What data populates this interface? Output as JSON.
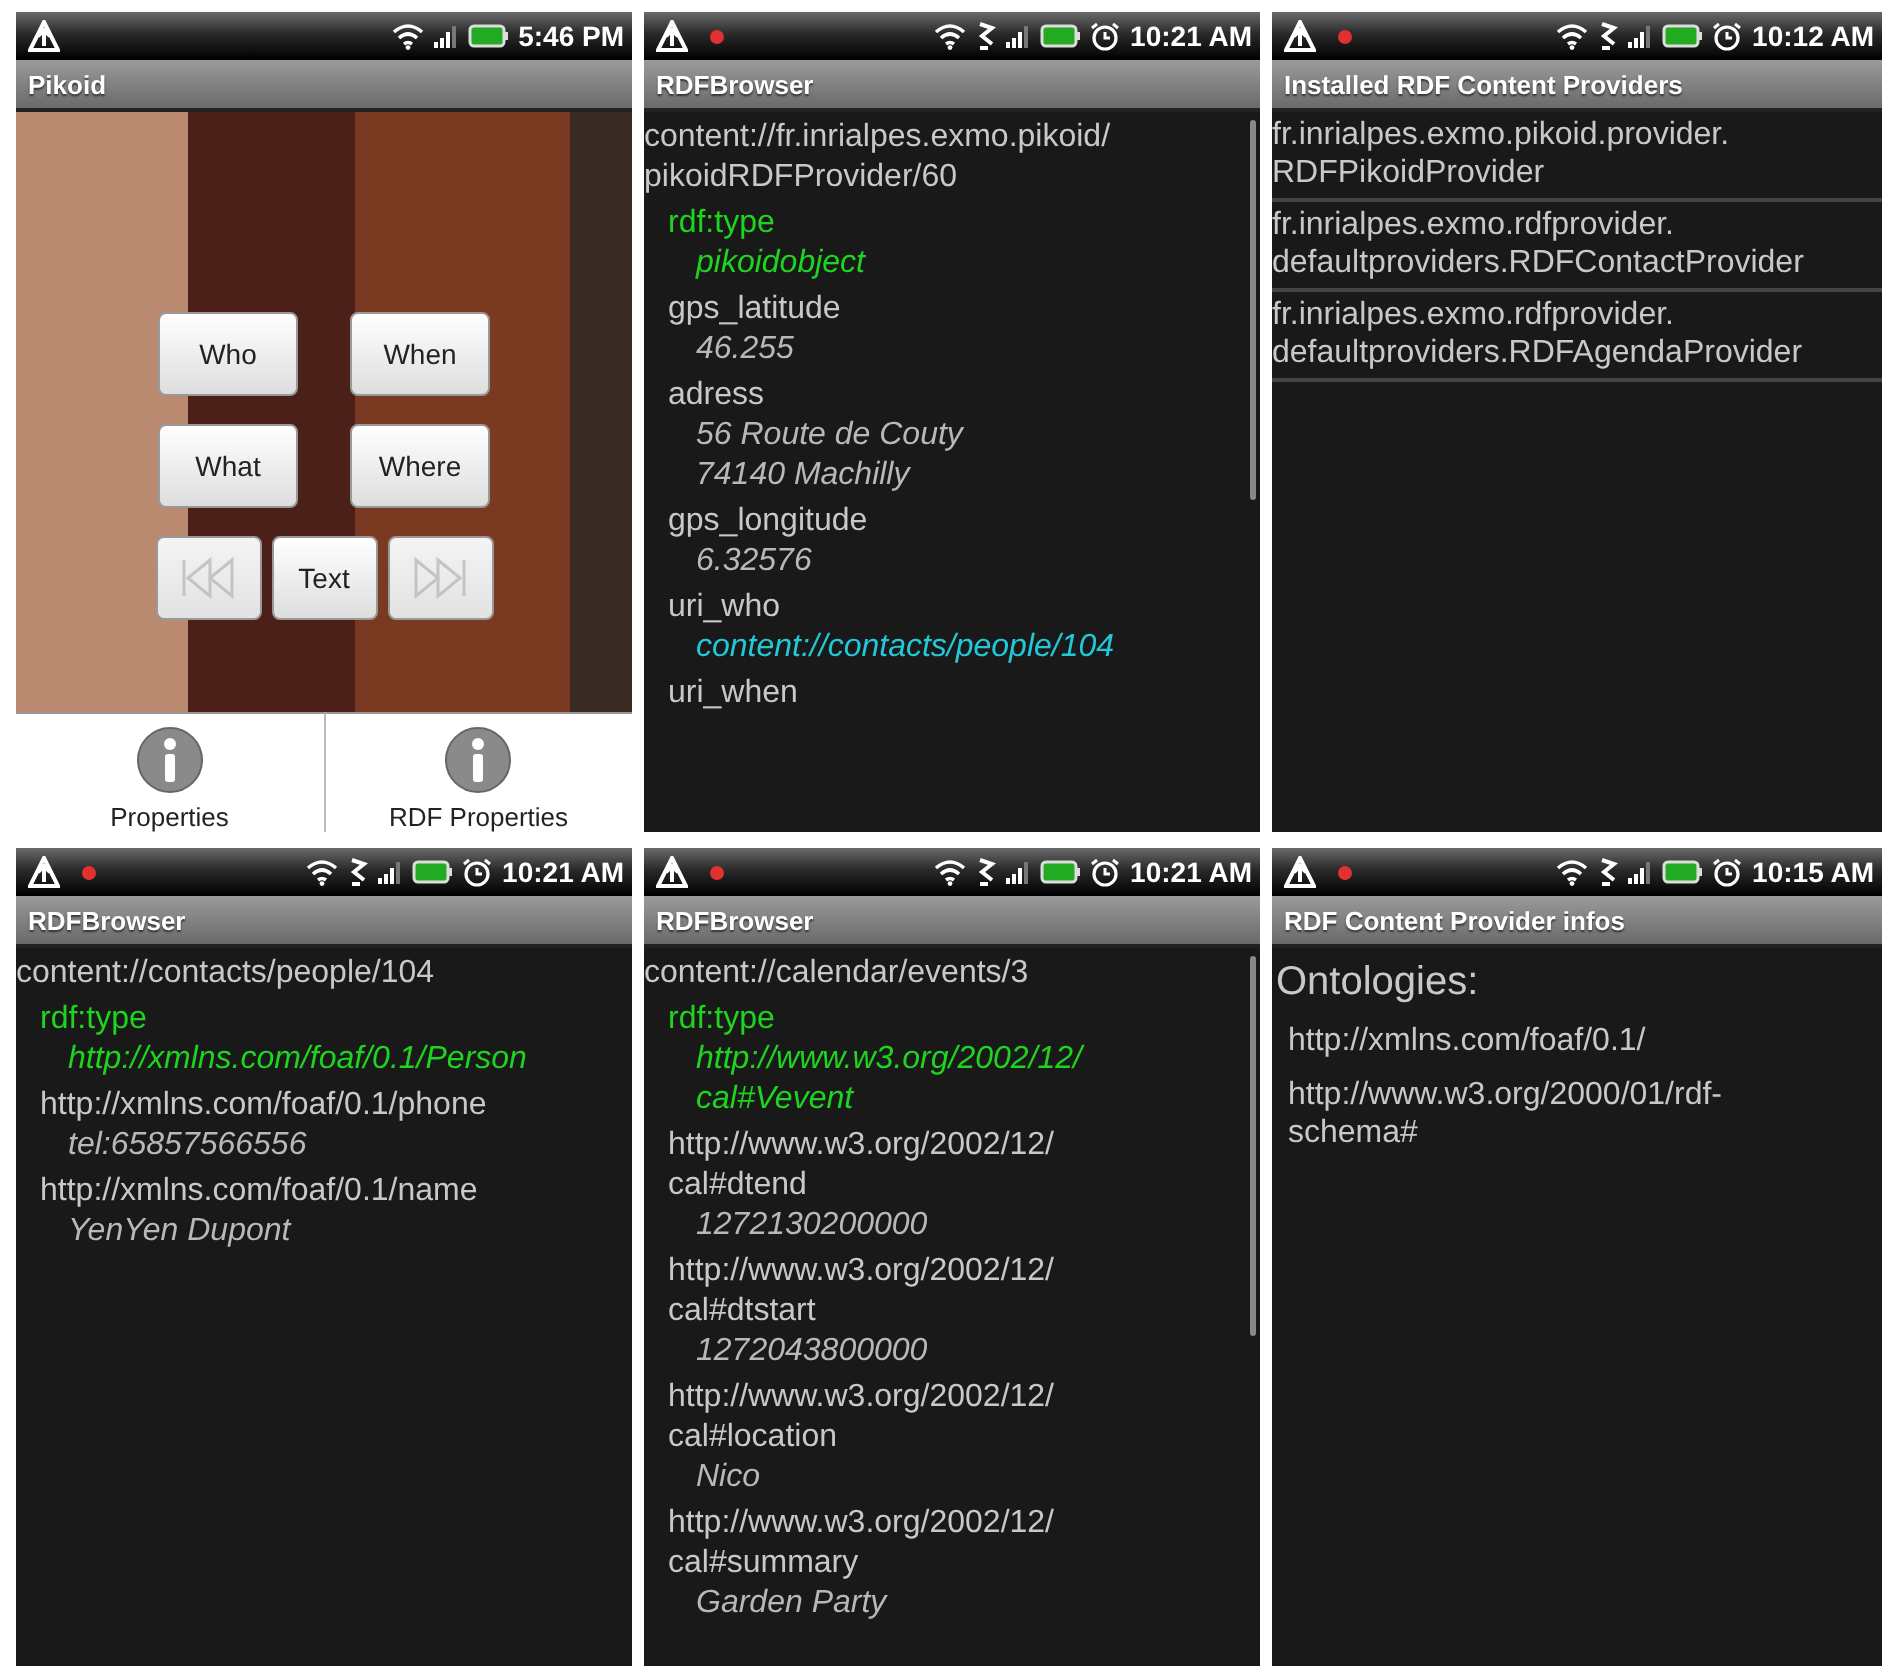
{
  "screens": [
    {
      "kind": "camera",
      "status_bar": {
        "time": "5:46 PM",
        "notification_dot": false,
        "usb": false,
        "alarm": false
      },
      "title": "Pikoid",
      "buttons": [
        {
          "label": "Who"
        },
        {
          "label": "When"
        },
        {
          "label": "What"
        },
        {
          "label": "Where"
        }
      ],
      "nav": [
        {
          "kind": "prev",
          "disabled": true
        },
        {
          "kind": "text",
          "label": "Text",
          "disabled": false
        },
        {
          "kind": "next",
          "disabled": true
        }
      ],
      "tabs": [
        {
          "label": "Properties"
        },
        {
          "label": "RDF Properties"
        }
      ]
    },
    {
      "kind": "resource",
      "status_bar": {
        "time": "10:21 AM",
        "notification_dot": true,
        "usb": true,
        "alarm": true
      },
      "title": "RDFBrowser",
      "scrollbar": true,
      "subject": [
        "content://fr.inrialpes.exmo.pikoid/",
        "pikoidRDFProvider/60"
      ],
      "properties": [
        {
          "kind": "type",
          "name": [
            "rdf:type"
          ],
          "value": [
            "pikoidobject"
          ]
        },
        {
          "kind": "literal",
          "name": [
            "gps_latitude"
          ],
          "value": [
            "46.255"
          ]
        },
        {
          "kind": "literal",
          "name": [
            "adress"
          ],
          "value": [
            "56 Route de Couty",
            "74140 Machilly"
          ]
        },
        {
          "kind": "literal",
          "name": [
            "gps_longitude"
          ],
          "value": [
            "6.32576"
          ]
        },
        {
          "kind": "link",
          "name": [
            "uri_who"
          ],
          "value": [
            "content://contacts/people/104"
          ]
        },
        {
          "kind": "literal",
          "name": [
            "uri_when"
          ]
        }
      ]
    },
    {
      "kind": "providers",
      "status_bar": {
        "time": "10:12 AM",
        "notification_dot": true,
        "usb": true,
        "alarm": true
      },
      "title": "Installed RDF Content Providers",
      "items": [
        {
          "lines": [
            "fr.inrialpes.exmo.pikoid.provider.",
            "RDFPikoidProvider"
          ]
        },
        {
          "lines": [
            "fr.inrialpes.exmo.rdfprovider.",
            "defaultproviders.RDFContactProvider"
          ]
        },
        {
          "lines": [
            "fr.inrialpes.exmo.rdfprovider.",
            "defaultproviders.RDFAgendaProvider"
          ]
        }
      ]
    },
    {
      "kind": "resource",
      "status_bar": {
        "time": "10:21 AM",
        "notification_dot": true,
        "usb": true,
        "alarm": true
      },
      "title": "RDFBrowser",
      "scrollbar": false,
      "subject": [
        "content://contacts/people/104"
      ],
      "properties": [
        {
          "kind": "type",
          "name": [
            "rdf:type"
          ],
          "value": [
            "http://xmlns.com/foaf/0.1/Person"
          ]
        },
        {
          "kind": "literal",
          "name": [
            "http://xmlns.com/foaf/0.1/phone"
          ],
          "value": [
            "tel:65857566556"
          ]
        },
        {
          "kind": "literal",
          "name": [
            "http://xmlns.com/foaf/0.1/name"
          ],
          "value": [
            "YenYen Dupont"
          ]
        }
      ]
    },
    {
      "kind": "resource",
      "status_bar": {
        "time": "10:21 AM",
        "notification_dot": true,
        "usb": true,
        "alarm": true
      },
      "title": "RDFBrowser",
      "scrollbar": true,
      "subject": [
        "content://calendar/events/3"
      ],
      "properties": [
        {
          "kind": "type",
          "name": [
            "rdf:type"
          ],
          "value": [
            "http://www.w3.org/2002/12/",
            "cal#Vevent"
          ]
        },
        {
          "kind": "literal",
          "name": [
            "http://www.w3.org/2002/12/",
            "cal#dtend"
          ],
          "value": [
            "1272130200000"
          ]
        },
        {
          "kind": "literal",
          "name": [
            "http://www.w3.org/2002/12/",
            "cal#dtstart"
          ],
          "value": [
            "1272043800000"
          ]
        },
        {
          "kind": "literal",
          "name": [
            "http://www.w3.org/2002/12/",
            "cal#location"
          ],
          "value": [
            "Nico"
          ]
        },
        {
          "kind": "literal",
          "name": [
            "http://www.w3.org/2002/12/",
            "cal#summary"
          ],
          "value": [
            "Garden Party"
          ]
        }
      ]
    },
    {
      "kind": "infos",
      "status_bar": {
        "time": "10:15 AM",
        "notification_dot": true,
        "usb": true,
        "alarm": true
      },
      "title": "RDF Content Provider infos",
      "heading": "Ontologies:",
      "ontologies": [
        {
          "lines": [
            "http://xmlns.com/foaf/0.1/"
          ]
        },
        {
          "lines": [
            "http://www.w3.org/2000/01/rdf-",
            "schema#"
          ]
        }
      ]
    }
  ]
}
